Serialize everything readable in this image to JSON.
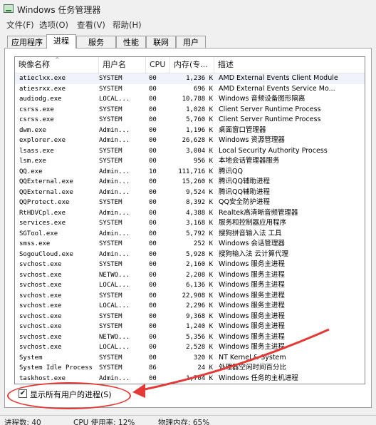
{
  "window": {
    "title": "Windows 任务管理器",
    "icon": "task-manager-icon"
  },
  "menu": [
    "文件(F)",
    "选项(O)",
    "查看(V)",
    "帮助(H)"
  ],
  "tabs": [
    "应用程序",
    "进程",
    "服务",
    "性能",
    "联网",
    "用户"
  ],
  "active_tab": "进程",
  "columns": [
    "映像名称",
    "用户名",
    "CPU",
    "内存(专...",
    "描述"
  ],
  "sort_indicator": "^",
  "rows": [
    {
      "name": "atieclxx.exe",
      "user": "SYSTEM",
      "cpu": "00",
      "mem": "1,236 K",
      "desc": "AMD External Events Client Module"
    },
    {
      "name": "atiesrxx.exe",
      "user": "SYSTEM",
      "cpu": "00",
      "mem": "696 K",
      "desc": "AMD External Events Service Mo..."
    },
    {
      "name": "audiodg.exe",
      "user": "LOCAL...",
      "cpu": "00",
      "mem": "10,788 K",
      "desc": "Windows 音频设备图形隔离"
    },
    {
      "name": "csrss.exe",
      "user": "SYSTEM",
      "cpu": "00",
      "mem": "1,028 K",
      "desc": "Client Server Runtime Process"
    },
    {
      "name": "csrss.exe",
      "user": "SYSTEM",
      "cpu": "00",
      "mem": "5,760 K",
      "desc": "Client Server Runtime Process"
    },
    {
      "name": "dwm.exe",
      "user": "Admin...",
      "cpu": "00",
      "mem": "1,196 K",
      "desc": "桌面窗口管理器"
    },
    {
      "name": "explorer.exe",
      "user": "Admin...",
      "cpu": "00",
      "mem": "26,628 K",
      "desc": "Windows 资源管理器"
    },
    {
      "name": "lsass.exe",
      "user": "SYSTEM",
      "cpu": "00",
      "mem": "3,004 K",
      "desc": "Local Security Authority Process"
    },
    {
      "name": "lsm.exe",
      "user": "SYSTEM",
      "cpu": "00",
      "mem": "956 K",
      "desc": "本地会话管理器服务"
    },
    {
      "name": "QQ.exe",
      "user": "Admin...",
      "cpu": "10",
      "mem": "111,716 K",
      "desc": "腾讯QQ"
    },
    {
      "name": "QQExternal.exe",
      "user": "Admin...",
      "cpu": "00",
      "mem": "15,260 K",
      "desc": "腾讯QQ辅助进程"
    },
    {
      "name": "QQExternal.exe",
      "user": "Admin...",
      "cpu": "00",
      "mem": "9,524 K",
      "desc": "腾讯QQ辅助进程"
    },
    {
      "name": "QQProtect.exe",
      "user": "SYSTEM",
      "cpu": "00",
      "mem": "8,392 K",
      "desc": "QQ安全防护进程"
    },
    {
      "name": "RtHDVCpl.exe",
      "user": "Admin...",
      "cpu": "00",
      "mem": "4,388 K",
      "desc": "Realtek高清晰音频管理器"
    },
    {
      "name": "services.exe",
      "user": "SYSTEM",
      "cpu": "00",
      "mem": "3,168 K",
      "desc": "服务和控制器应用程序"
    },
    {
      "name": "SGTool.exe",
      "user": "Admin...",
      "cpu": "00",
      "mem": "5,792 K",
      "desc": "搜狗拼音输入法 工具"
    },
    {
      "name": "smss.exe",
      "user": "SYSTEM",
      "cpu": "00",
      "mem": "252 K",
      "desc": "Windows 会话管理器"
    },
    {
      "name": "SogouCloud.exe",
      "user": "Admin...",
      "cpu": "00",
      "mem": "5,928 K",
      "desc": "搜狗输入法 云计算代理"
    },
    {
      "name": "svchost.exe",
      "user": "SYSTEM",
      "cpu": "00",
      "mem": "2,160 K",
      "desc": "Windows 服务主进程"
    },
    {
      "name": "svchost.exe",
      "user": "NETWO...",
      "cpu": "00",
      "mem": "2,208 K",
      "desc": "Windows 服务主进程"
    },
    {
      "name": "svchost.exe",
      "user": "LOCAL...",
      "cpu": "00",
      "mem": "6,136 K",
      "desc": "Windows 服务主进程"
    },
    {
      "name": "svchost.exe",
      "user": "SYSTEM",
      "cpu": "00",
      "mem": "22,908 K",
      "desc": "Windows 服务主进程"
    },
    {
      "name": "svchost.exe",
      "user": "LOCAL...",
      "cpu": "00",
      "mem": "2,296 K",
      "desc": "Windows 服务主进程"
    },
    {
      "name": "svchost.exe",
      "user": "SYSTEM",
      "cpu": "00",
      "mem": "9,368 K",
      "desc": "Windows 服务主进程"
    },
    {
      "name": "svchost.exe",
      "user": "SYSTEM",
      "cpu": "00",
      "mem": "1,240 K",
      "desc": "Windows 服务主进程"
    },
    {
      "name": "svchost.exe",
      "user": "NETWO...",
      "cpu": "00",
      "mem": "5,356 K",
      "desc": "Windows 服务主进程"
    },
    {
      "name": "svchost.exe",
      "user": "LOCAL...",
      "cpu": "00",
      "mem": "2,528 K",
      "desc": "Windows 服务主进程"
    },
    {
      "name": "System",
      "user": "SYSTEM",
      "cpu": "00",
      "mem": "320 K",
      "desc": "NT Kernel & System"
    },
    {
      "name": "System Idle Process",
      "user": "SYSTEM",
      "cpu": "86",
      "mem": "24 K",
      "desc": "处理器空闲时间百分比"
    },
    {
      "name": "taskhost.exe",
      "user": "Admin...",
      "cpu": "00",
      "mem": "1,704 K",
      "desc": "Windows 任务的主机进程"
    }
  ],
  "show_all_checkbox": {
    "label": "显示所有用户的进程(S)",
    "checked": true,
    "mark": "✔"
  },
  "status": {
    "processes": "进程数: 40",
    "cpu": "CPU 使用率: 12%",
    "memory": "物理内存: 65%"
  },
  "annotation_color": "#e53935"
}
